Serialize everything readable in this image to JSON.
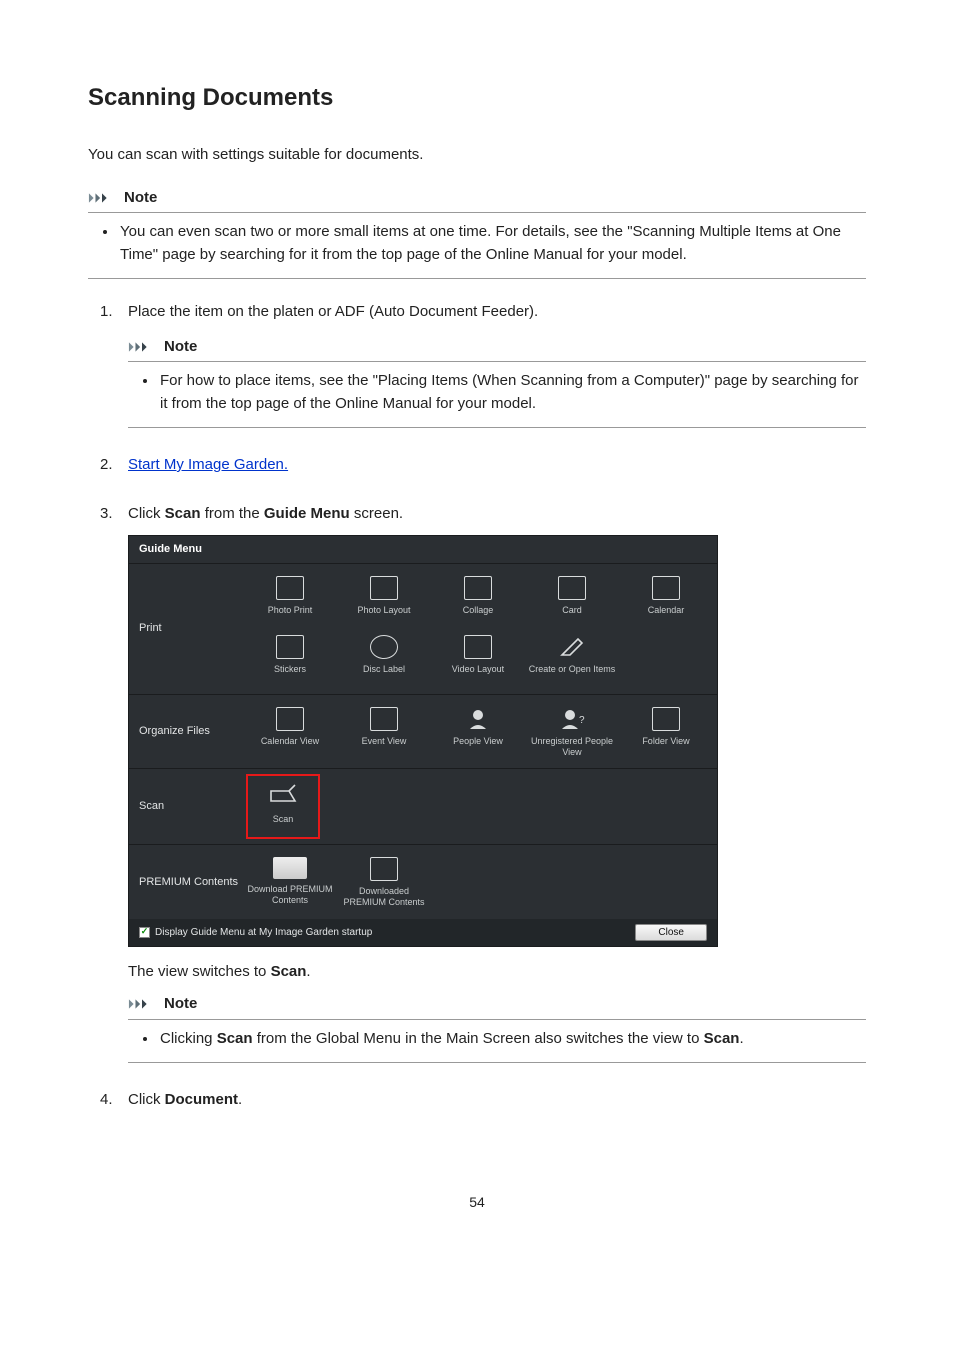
{
  "page_title": "Scanning Documents",
  "intro": "You can scan with settings suitable for documents.",
  "note_label": "Note",
  "top_note": "You can even scan two or more small items at one time. For details, see the \"Scanning Multiple Items at One Time\" page by searching for it from the top page of the Online Manual for your model.",
  "steps": {
    "s1": {
      "text": "Place the item on the platen or ADF (Auto Document Feeder).",
      "note": "For how to place items, see the \"Placing Items (When Scanning from a Computer)\" page by searching for it from the top page of the Online Manual for your model."
    },
    "s2": {
      "link_text": "Start My Image Garden."
    },
    "s3": {
      "pre": "Click ",
      "b1": "Scan",
      "mid": " from the ",
      "b2": "Guide Menu",
      "post": " screen.",
      "after_pre": "The view switches to ",
      "after_b": "Scan",
      "after_post": ".",
      "note_pre": "Clicking ",
      "note_b1": "Scan",
      "note_mid": " from the Global Menu in the Main Screen also switches the view to ",
      "note_b2": "Scan",
      "note_post": "."
    },
    "s4": {
      "pre": "Click ",
      "b1": "Document",
      "post": "."
    }
  },
  "guide_menu": {
    "title": "Guide Menu",
    "sections": {
      "print": {
        "label": "Print",
        "items": [
          "Photo Print",
          "Photo Layout",
          "Collage",
          "Card",
          "Calendar",
          "Stickers",
          "Disc Label",
          "Video Layout",
          "Create or Open Items"
        ]
      },
      "organize": {
        "label": "Organize Files",
        "items": [
          "Calendar View",
          "Event View",
          "People View",
          "Unregistered People View",
          "Folder View"
        ]
      },
      "scan": {
        "label": "Scan",
        "items": [
          "Scan"
        ]
      },
      "premium": {
        "label": "PREMIUM Contents",
        "items": [
          "Download PREMIUM Contents",
          "Downloaded PREMIUM Contents"
        ]
      }
    },
    "checkbox_label": "Display Guide Menu at My Image Garden startup",
    "close_label": "Close"
  },
  "page_number": "54"
}
